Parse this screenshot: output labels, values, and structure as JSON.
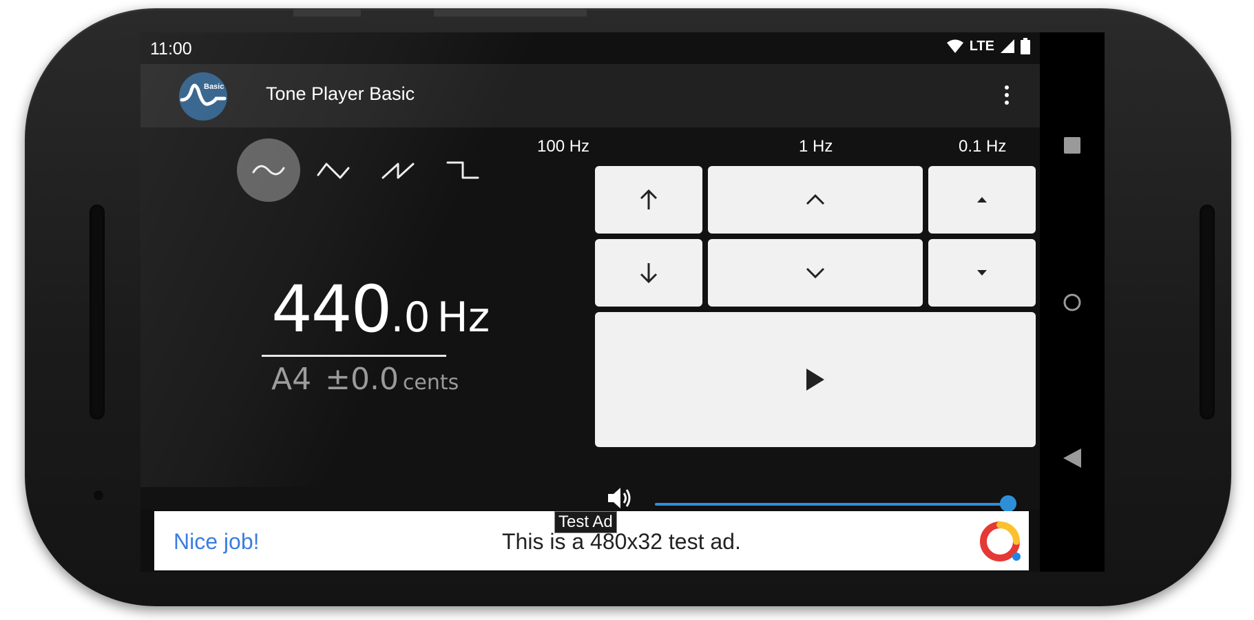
{
  "status_bar": {
    "time": "11:00",
    "network": "LTE",
    "icons": [
      "wifi-icon",
      "cellular-signal-icon",
      "battery-icon"
    ]
  },
  "app_bar": {
    "title": "Tone Player Basic",
    "logo_text": "Basic",
    "menu_icon": "overflow-menu-icon"
  },
  "waveforms": [
    {
      "name": "sine",
      "icon": "sine-wave-icon",
      "selected": true
    },
    {
      "name": "triangle",
      "icon": "triangle-wave-icon",
      "selected": false
    },
    {
      "name": "sawtooth",
      "icon": "sawtooth-wave-icon",
      "selected": false
    },
    {
      "name": "square",
      "icon": "square-wave-icon",
      "selected": false
    }
  ],
  "frequency": {
    "integer": "440",
    "fraction": ".0",
    "unit": "Hz",
    "note": "A4",
    "cents_value": "±0.0",
    "cents_label": "cents"
  },
  "step_labels": {
    "coarse": "100 Hz",
    "medium": "1 Hz",
    "fine": "0.1 Hz"
  },
  "controls": {
    "up_100_icon": "arrow-up-icon",
    "up_1_icon": "chevron-up-icon",
    "up_01_icon": "caret-up-icon",
    "down_100_icon": "arrow-down-icon",
    "down_1_icon": "chevron-down-icon",
    "down_01_icon": "caret-down-icon",
    "play_icon": "play-icon"
  },
  "volume": {
    "icon": "volume-icon",
    "level": 1.0,
    "accent_color": "#2e8fd8"
  },
  "nav_bar": {
    "icons": [
      "recents-square-icon",
      "home-circle-icon",
      "back-triangle-icon"
    ]
  },
  "ad": {
    "tag": "Test Ad",
    "headline": "Nice job!",
    "body": "This is a 480x32 test ad.",
    "logo_icon": "ad-logo-icon"
  }
}
